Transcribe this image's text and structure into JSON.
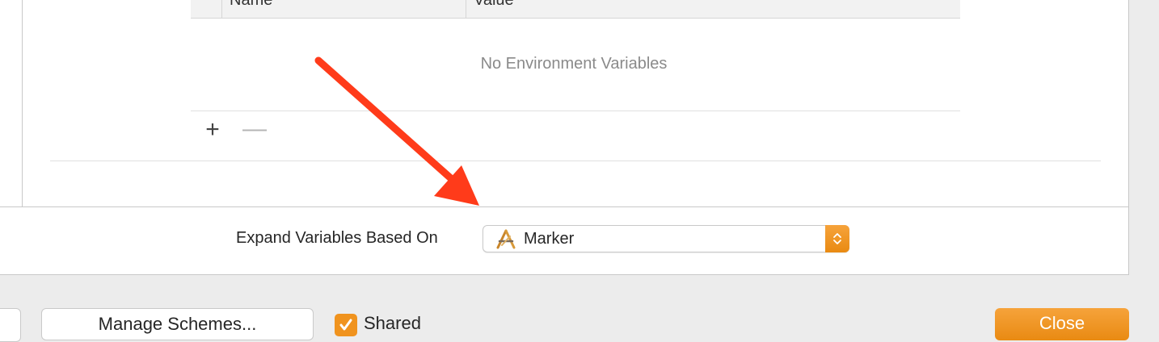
{
  "env_table": {
    "columns": [
      "Name",
      "Value"
    ],
    "empty_message": "No Environment Variables",
    "add_label": "+",
    "remove_label": "—"
  },
  "expand": {
    "label": "Expand Variables Based On",
    "selected": "Marker",
    "icon": "app-target-icon"
  },
  "footer": {
    "manage_schemes": "Manage Schemes...",
    "shared_label": "Shared",
    "shared_checked": true,
    "close_label": "Close"
  },
  "annotation": {
    "arrow_color": "#ff3b1a"
  },
  "colors": {
    "accent": "#f0931e"
  }
}
